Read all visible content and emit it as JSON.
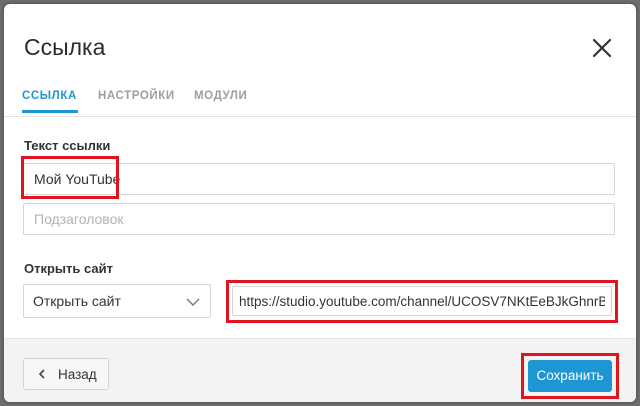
{
  "dialog": {
    "title": "Ссылка"
  },
  "icons": {
    "close": "close-icon",
    "chevron": "chevron-down-icon",
    "back": "chevron-left-icon"
  },
  "tabs": [
    {
      "label": "ССЫЛКА",
      "active": true
    },
    {
      "label": "НАСТРОЙКИ",
      "active": false
    },
    {
      "label": "МОДУЛИ",
      "active": false
    }
  ],
  "link_text": {
    "label": "Текст ссылки",
    "value": "Мой YouTube",
    "subtitle_placeholder": "Подзаголовок"
  },
  "open_site": {
    "label": "Открыть сайт",
    "selected": "Открыть сайт",
    "url": "https://studio.youtube.com/channel/UCOSV7NKtEeBJkGhnrB"
  },
  "footer": {
    "back_label": "Назад",
    "save_label": "Сохранить"
  },
  "colors": {
    "accent": "#1e96d4",
    "highlight": "#e0141e"
  }
}
